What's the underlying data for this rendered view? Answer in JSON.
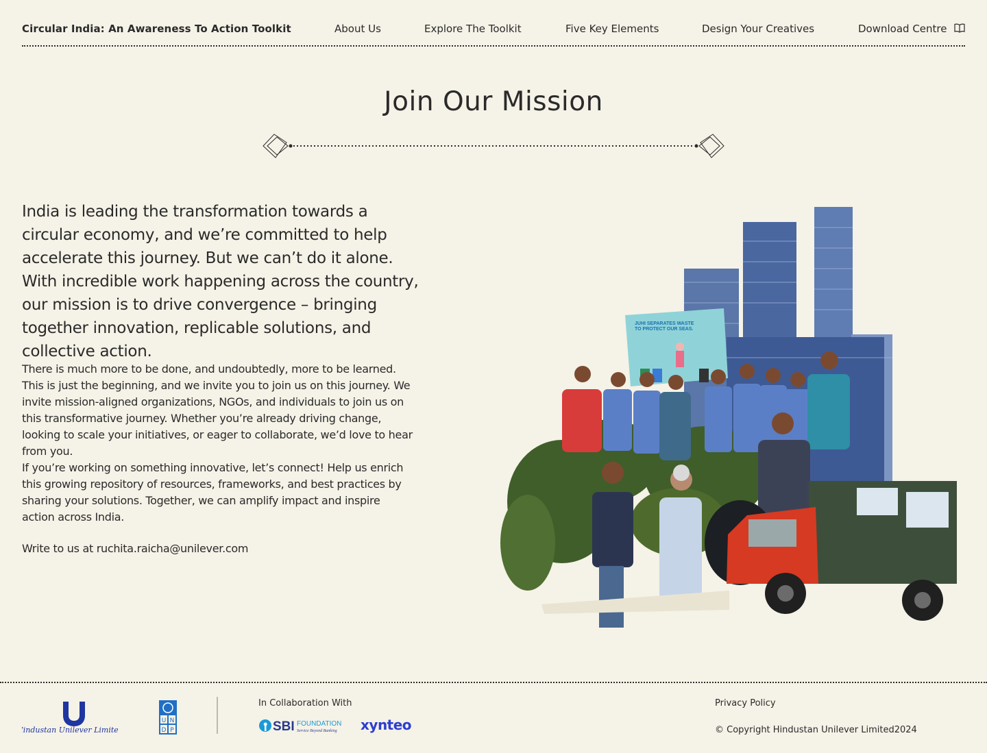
{
  "header": {
    "brand": "Circular India: An Awareness To Action Toolkit",
    "nav": [
      {
        "label": "About Us"
      },
      {
        "label": "Explore The Toolkit"
      },
      {
        "label": "Five Key Elements"
      },
      {
        "label": "Design Your Creatives"
      },
      {
        "label": "Download Centre",
        "icon": "book-icon"
      }
    ]
  },
  "main": {
    "title": "Join Our Mission",
    "lead": "India is leading the transformation towards a circular economy, and we’re committed to help accelerate this journey. But we can’t do it alone. With incredible work happening across the country, our mission is to drive convergence – bringing together innovation, replicable solutions, and collective action.",
    "paragraphs": [
      "There is much more to be done, and undoubtedly, more to be learned. This is just the beginning, and we invite you to join us on this journey. We invite mission-aligned organizations, NGOs, and individuals to join us on this transformative journey. Whether you’re already driving change, looking to scale your initiatives, or eager to collaborate, we’d love to hear from you.",
      "If you’re working on something innovative, let’s connect! Help us enrich this growing repository of resources, frameworks, and best practices by sharing your solutions. Together, we can amplify impact and inspire action across India."
    ],
    "contact": "Write to us at ruchita.raicha@unilever.com",
    "collage": {
      "poster_title_1": "JUHI SEPARATES WASTE",
      "poster_title_2": "TO PROTECT OUR SEAS."
    }
  },
  "footer": {
    "hul_logo_text": "Hindustan Unilever Limited",
    "undp_logo_text": "UNDP",
    "collab_label": "In Collaboration With",
    "sbi_logo_text": "SBI",
    "sbi_foundation": "FOUNDATION",
    "sbi_tagline": "Service Beyond Banking",
    "xynteo_logo_text": "xynteo",
    "privacy": "Privacy Policy",
    "copyright": "© Copyright Hindustan Unilever Limited2024"
  },
  "colors": {
    "background": "#f5f2e7",
    "text": "#2a2a2a",
    "hul_blue": "#1f36a0",
    "undp_blue": "#1f6fc5",
    "xynteo_blue": "#2d3fd0",
    "truck_red": "#d63a22",
    "truck_green": "#3d4f3a"
  }
}
